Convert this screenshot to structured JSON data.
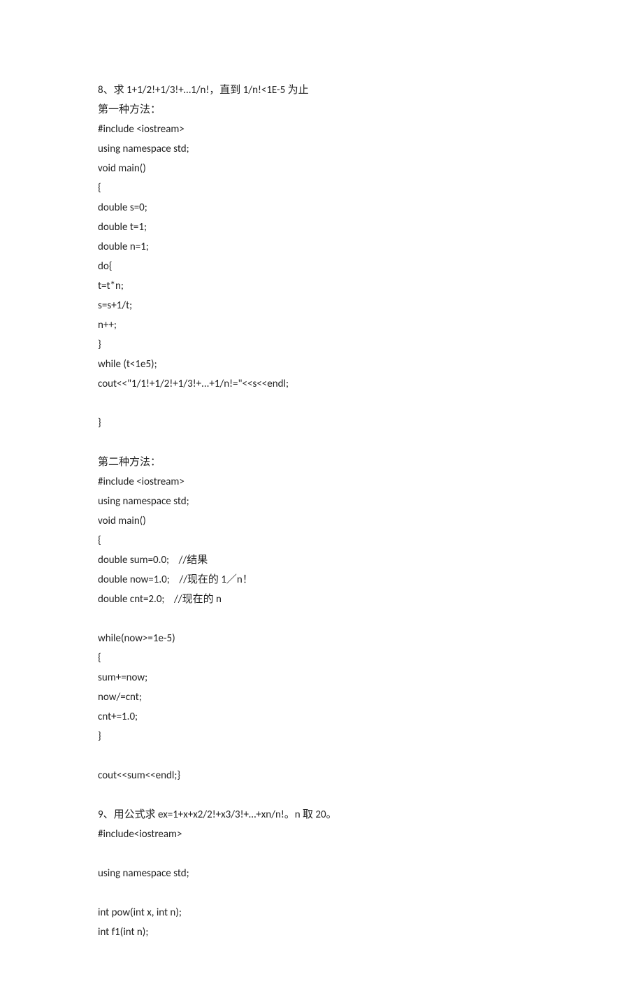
{
  "lines": [
    "8、求 1+1/2!+1/3!+…1/n!，直到 1/n!<1E-5 为止",
    "第一种方法：",
    "#include <iostream>",
    "using namespace std;",
    "void main()",
    "{",
    "double s=0;",
    "double t=1;",
    "double n=1;",
    "do{",
    "t=t*n;",
    "s=s+1/t;",
    "n++;",
    "}",
    "while (t<1e5);",
    "cout<<\"1/1!+1/2!+1/3!+...+1/n!=\"<<s<<endl;",
    "",
    "}",
    "",
    "第二种方法：",
    "#include <iostream>",
    "using namespace std;",
    "void main()",
    "{",
    "double sum=0.0;    //结果",
    "double now=1.0;    //现在的 1／n！",
    "double cnt=2.0;    //现在的 n",
    "",
    "while(now>=1e-5)",
    "{",
    "sum+=now;",
    "now/=cnt;",
    "cnt+=1.0;",
    "}",
    "",
    "cout<<sum<<endl;}",
    "",
    "9、用公式求 ex=1+x+x2/2!+x3/3!+…+xn/n!。n 取 20。",
    "#include<iostream>",
    "",
    "using namespace std;",
    "",
    "int pow(int x, int n);",
    "int f1(int n);"
  ]
}
